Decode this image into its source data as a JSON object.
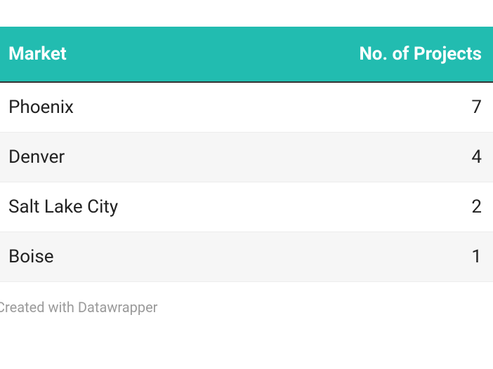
{
  "chart_data": {
    "type": "table",
    "columns": [
      "Market",
      "No. of Projects"
    ],
    "rows": [
      {
        "market": "Phoenix",
        "projects": 7
      },
      {
        "market": "Denver",
        "projects": 4
      },
      {
        "market": "Salt Lake City",
        "projects": 2
      },
      {
        "market": "Boise",
        "projects": 1
      }
    ]
  },
  "credit": "Created with Datawrapper"
}
